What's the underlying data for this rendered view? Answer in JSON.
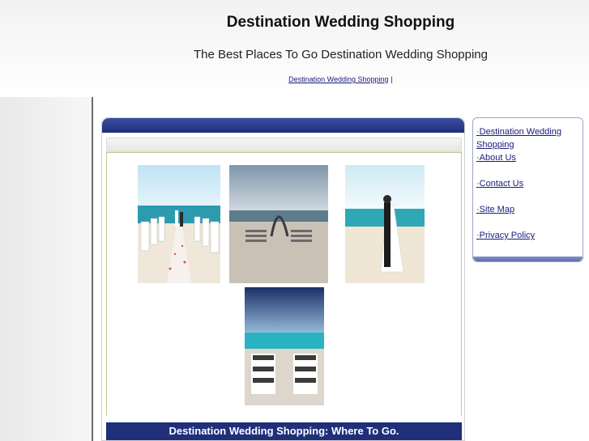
{
  "header": {
    "title": "Destination Wedding Shopping",
    "tagline": "The Best Places To Go Destination Wedding Shopping",
    "nav": [
      {
        "label": "Destination Wedding Shopping"
      }
    ],
    "nav_separator": "|"
  },
  "sidebar": {
    "bullet": "·",
    "links": [
      {
        "label": "Destination Wedding Shopping"
      },
      {
        "label": "About Us"
      },
      {
        "label": "Contact Us"
      },
      {
        "label": "Site Map"
      },
      {
        "label": "Privacy Policy"
      }
    ]
  },
  "main": {
    "photos": [
      {
        "name": "beach-ceremony-aisle-photo"
      },
      {
        "name": "beach-arch-chairs-photo"
      },
      {
        "name": "couple-on-beach-photo"
      },
      {
        "name": "beach-guests-aerial-photo"
      }
    ],
    "article_heading": "Destination Wedding Shopping: Where To Go."
  },
  "colors": {
    "nav_bar": "#1f2f7a",
    "link": "#1a1a7a",
    "sidebar_border": "#9aa3c8"
  }
}
